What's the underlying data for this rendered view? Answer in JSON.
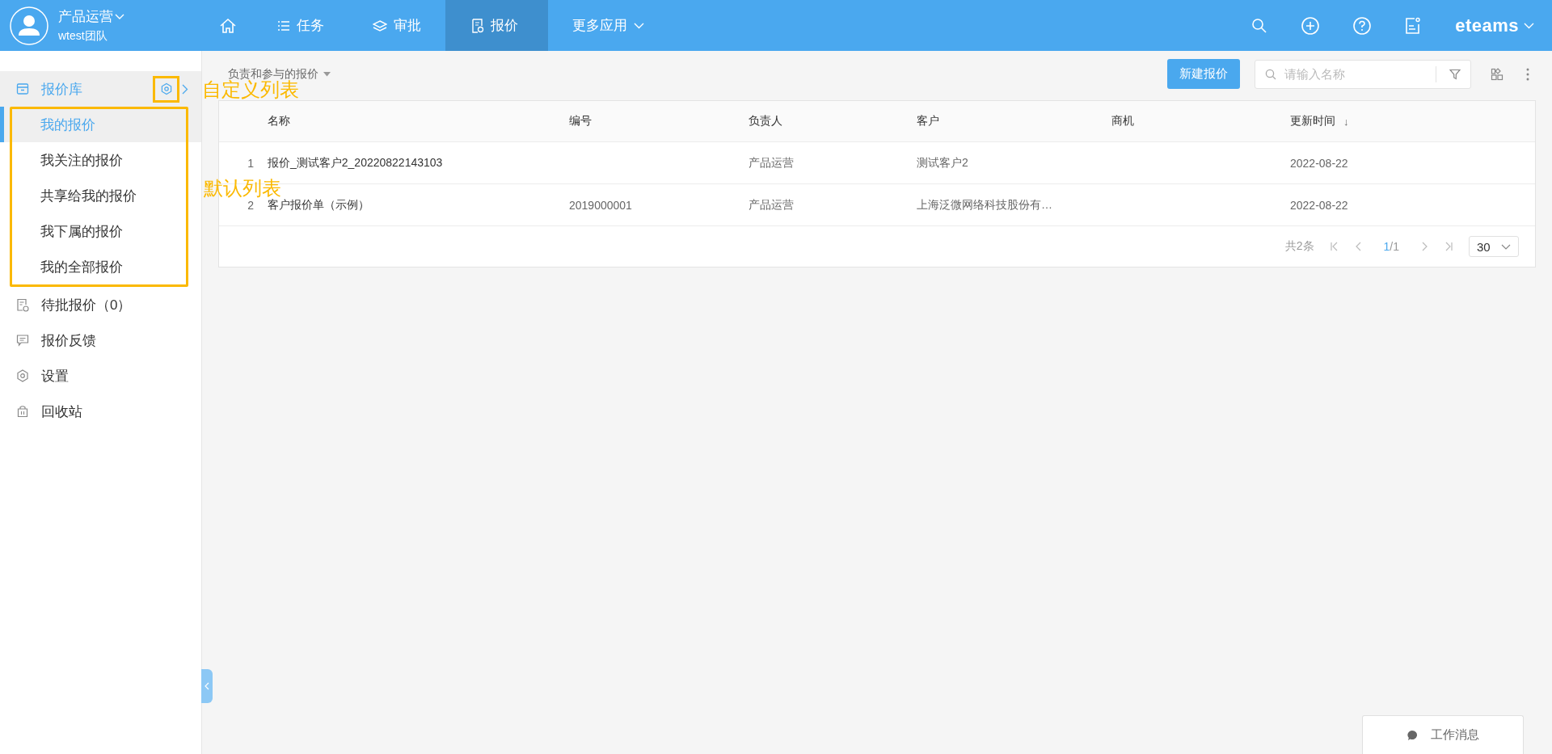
{
  "user": {
    "name": "产品运营",
    "team": "wtest团队"
  },
  "nav": [
    {
      "kind": "home",
      "selected": false
    },
    {
      "kind": "tasks",
      "label": "任务",
      "selected": false
    },
    {
      "kind": "approval",
      "label": "审批",
      "selected": false
    },
    {
      "kind": "quote",
      "label": "报价",
      "selected": true
    },
    {
      "kind": "more",
      "label": "更多应用",
      "selected": false
    }
  ],
  "brand": "eteams",
  "sidebar": {
    "items": [
      {
        "kind": "library",
        "label": "报价库",
        "children": [
          {
            "label": "我的报价",
            "selected": true
          },
          {
            "label": "我关注的报价",
            "selected": false
          },
          {
            "label": "共享给我的报价",
            "selected": false
          },
          {
            "label": "我下属的报价",
            "selected": false
          },
          {
            "label": "我的全部报价",
            "selected": false
          }
        ]
      },
      {
        "kind": "pending",
        "label": "待批报价（0）"
      },
      {
        "kind": "feedback",
        "label": "报价反馈"
      },
      {
        "kind": "settings",
        "label": "设置"
      },
      {
        "kind": "trash",
        "label": "回收站"
      }
    ]
  },
  "annotations": [
    {
      "kind": "gear",
      "label": "自定义列表",
      "color": "#fbb900"
    },
    {
      "kind": "list",
      "label": "默认列表",
      "color": "#fbb900"
    }
  ],
  "toolbar": {
    "view": "负责和参与的报价",
    "new_button": "新建报价",
    "search": {
      "placeholder": "请输入名称"
    }
  },
  "table": {
    "columns": [
      {
        "label": "名称"
      },
      {
        "label": "编号"
      },
      {
        "label": "负责人"
      },
      {
        "label": "客户"
      },
      {
        "label": "商机"
      },
      {
        "label": "更新时间",
        "sort_icon": "↓"
      }
    ],
    "rows": [
      {
        "index": "1",
        "name": "报价_测试客户2_20220822143103",
        "owner": "产品运营",
        "customer": "测试客户2",
        "updated": "2022-08-22"
      },
      {
        "index": "2",
        "name": "客户报价单（示例）",
        "code": "2019000001",
        "owner": "产品运营",
        "customer": "上海泛微网络科技股份有…",
        "updated": "2022-08-22"
      }
    ]
  },
  "pagination": {
    "total": "共2条",
    "current_page": "1",
    "page_count": "/1",
    "page_size": "30"
  },
  "work_messages": "工作消息"
}
